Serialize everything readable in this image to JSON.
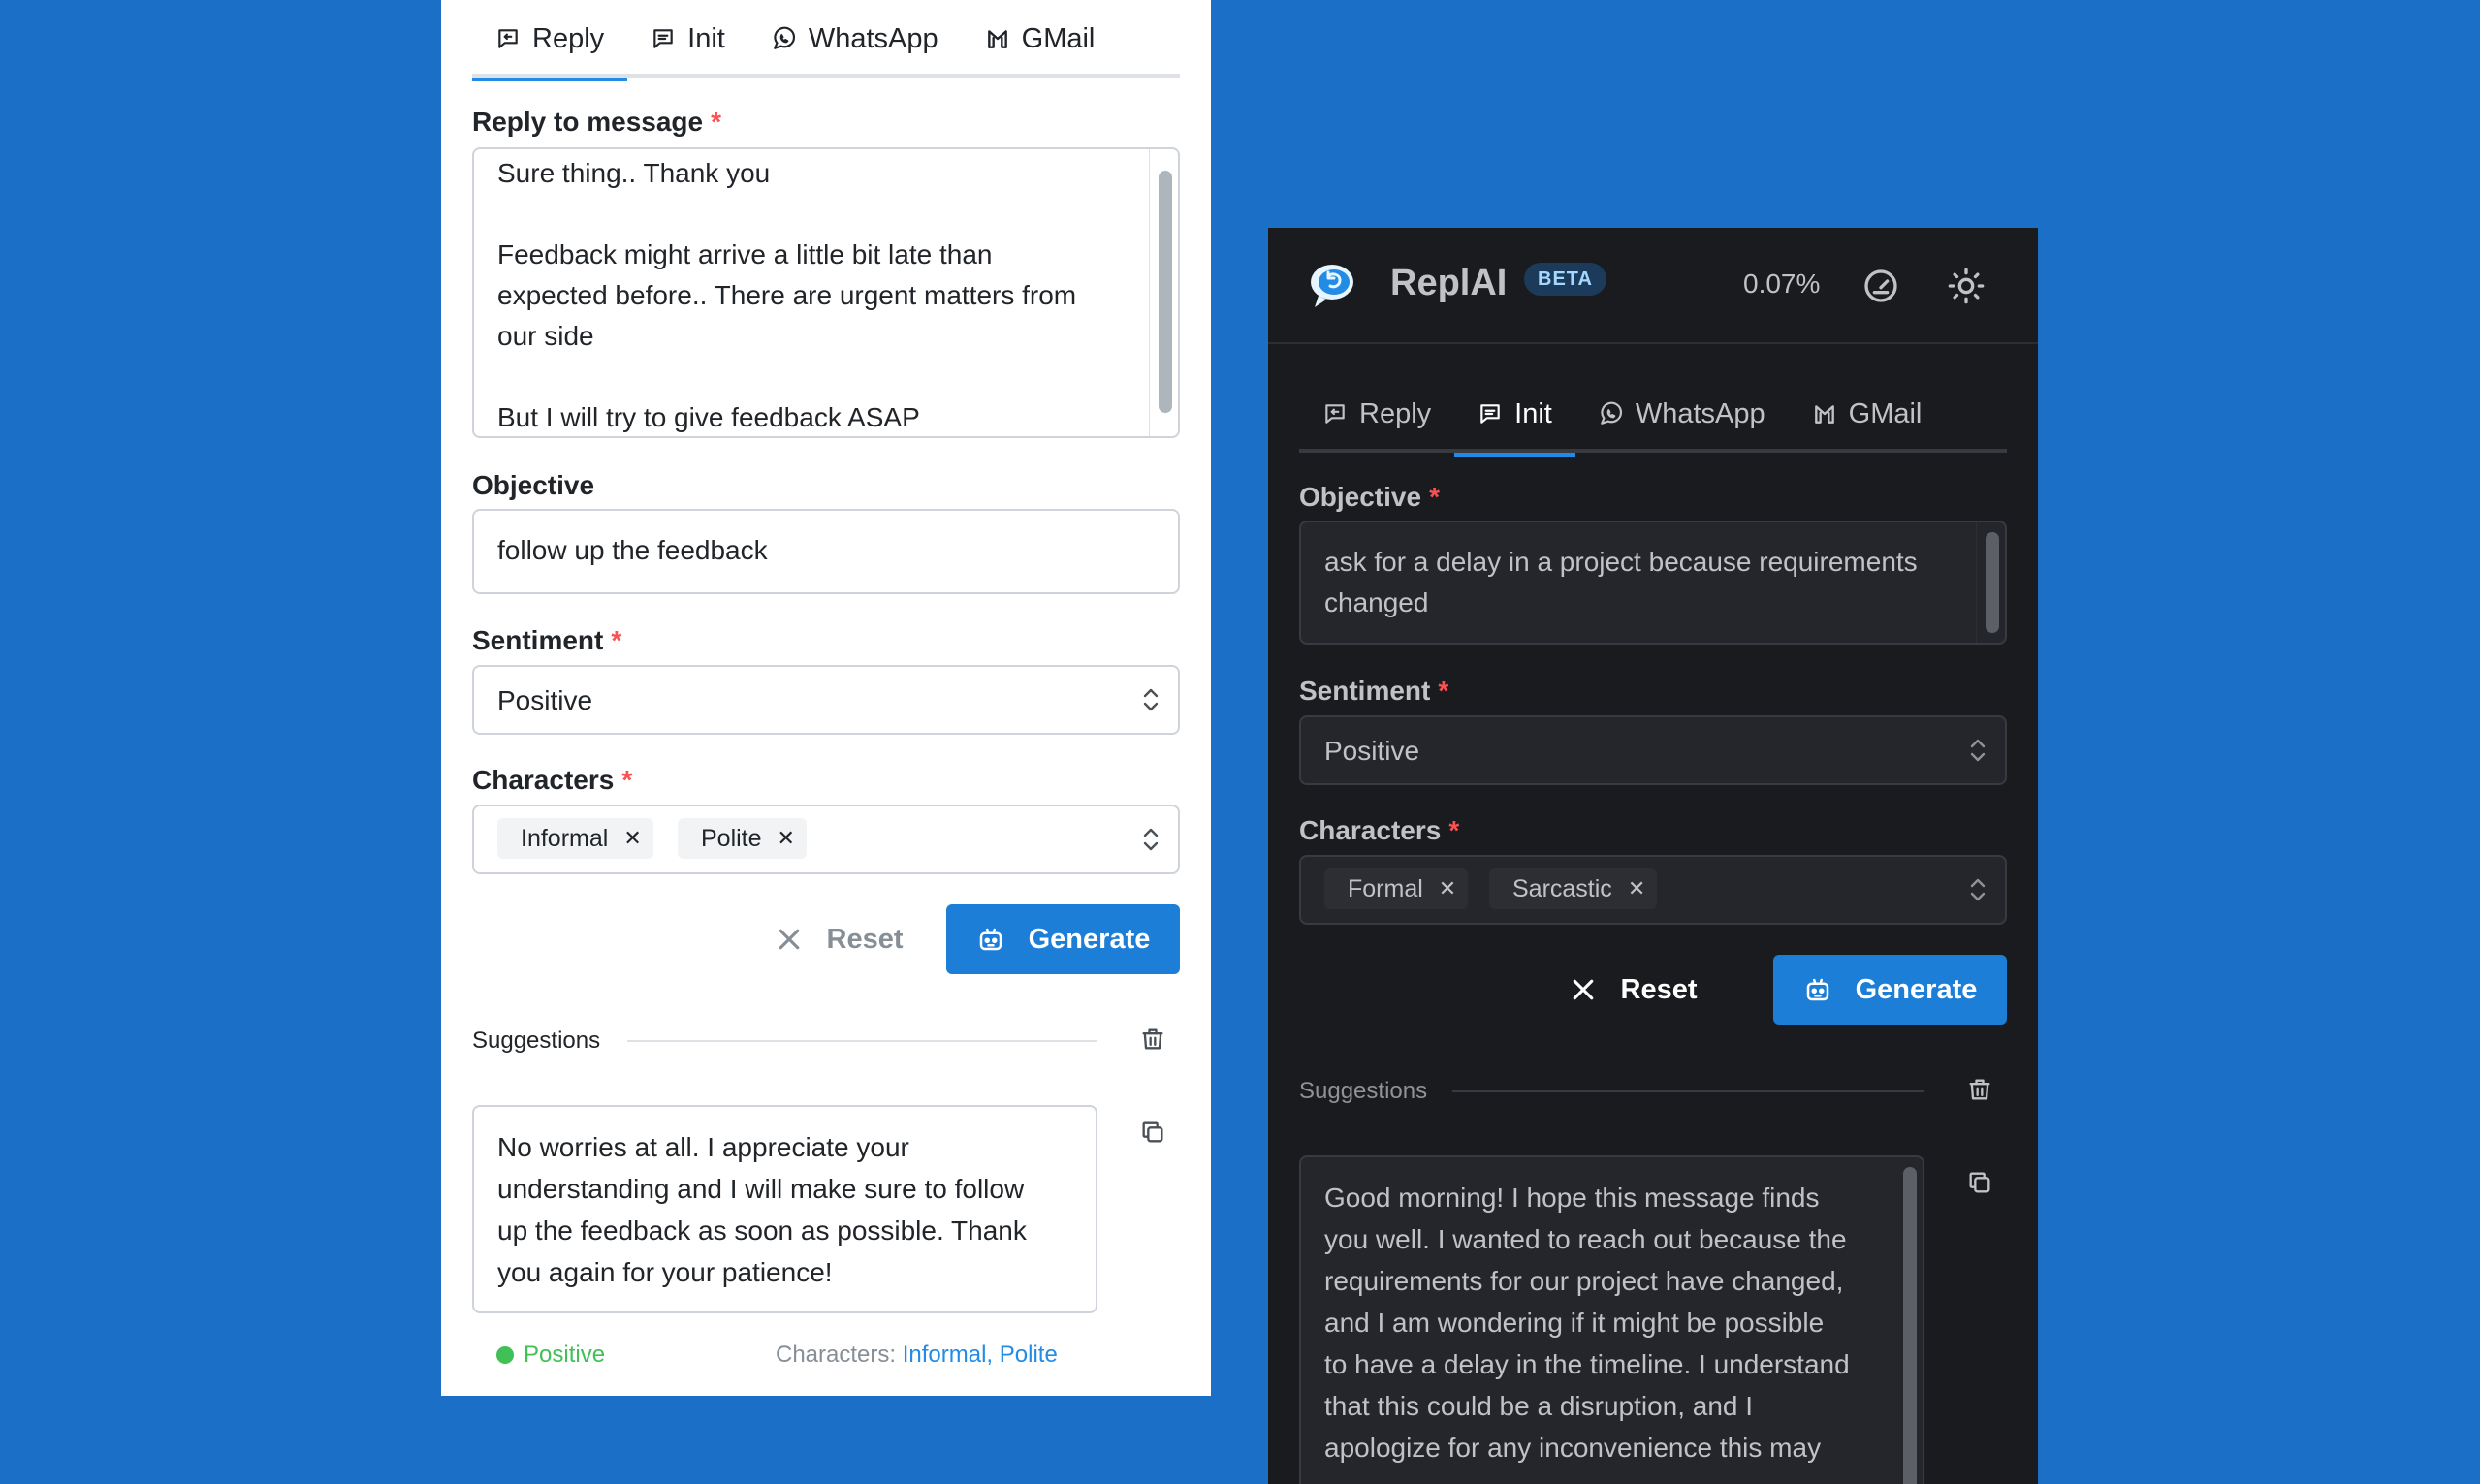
{
  "light": {
    "tabs": [
      {
        "label": "Reply",
        "icon": "message-reply-icon",
        "active": true
      },
      {
        "label": "Init",
        "icon": "message-icon",
        "active": false
      },
      {
        "label": "WhatsApp",
        "icon": "whatsapp-icon",
        "active": false
      },
      {
        "label": "GMail",
        "icon": "gmail-icon",
        "active": false
      }
    ],
    "reply_label": "Reply to message",
    "reply_lines": [
      "Sure thing.. Thank you",
      "",
      "Feedback might arrive a little bit late than",
      "expected before.. There are urgent matters from",
      "our side",
      "",
      "But I will try to give feedback ASAP"
    ],
    "objective_label": "Objective",
    "objective_value": "follow up the feedback",
    "sentiment_label": "Sentiment",
    "sentiment_value": "Positive",
    "characters_label": "Characters",
    "characters": [
      "Informal",
      "Polite"
    ],
    "reset_label": "Reset",
    "generate_label": "Generate",
    "suggestions_label": "Suggestions",
    "suggestion_lines": [
      "No worries at all. I appreciate your",
      "understanding and I will make sure to follow",
      "up the feedback as soon as possible. Thank",
      "you again for your patience!"
    ],
    "suggestion_sentiment": "Positive",
    "suggestion_characters_label": "Characters:",
    "suggestion_characters": "Informal, Polite"
  },
  "dark": {
    "brand": "ReplAI",
    "beta": "BETA",
    "usage": "0.07%",
    "tabs": [
      {
        "label": "Reply",
        "icon": "message-reply-icon",
        "active": false
      },
      {
        "label": "Init",
        "icon": "message-icon",
        "active": true
      },
      {
        "label": "WhatsApp",
        "icon": "whatsapp-icon",
        "active": false
      },
      {
        "label": "GMail",
        "icon": "gmail-icon",
        "active": false
      }
    ],
    "objective_label": "Objective",
    "objective_lines": [
      "ask for a delay in a project because requirements",
      "changed"
    ],
    "sentiment_label": "Sentiment",
    "sentiment_value": "Positive",
    "characters_label": "Characters",
    "characters": [
      "Formal",
      "Sarcastic"
    ],
    "reset_label": "Reset",
    "generate_label": "Generate",
    "suggestions_label": "Suggestions",
    "suggestion_lines": [
      "Good morning! I hope this message finds",
      "you well. I wanted to reach out because the",
      "requirements for our project have changed,",
      "and I am wondering if it might be possible",
      "to have a delay in the timeline. I understand",
      "that this could be a disruption, and I",
      "apologize for any inconvenience this may"
    ]
  },
  "colors": {
    "background": "#1b6fc7",
    "accent": "#1c7ed6",
    "required": "#fa5252",
    "positive": "#40c057",
    "dark_panel": "#1a1b1e"
  }
}
